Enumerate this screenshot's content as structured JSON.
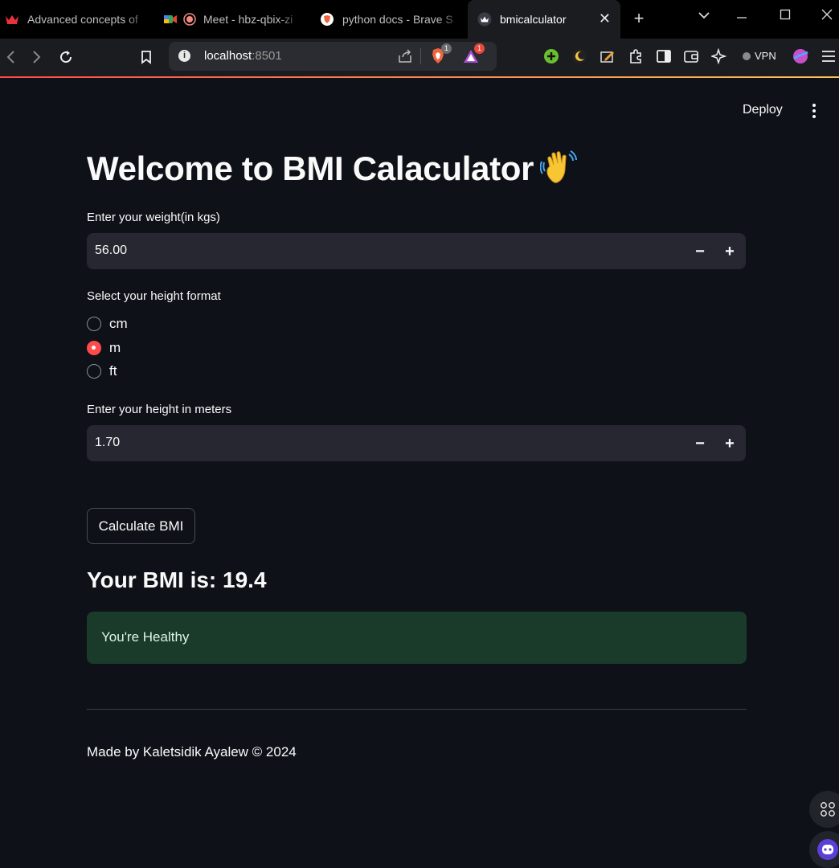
{
  "browser": {
    "tabs": [
      {
        "title": "Advanced concepts of",
        "icon": "brave-crown-icon"
      },
      {
        "title": "Meet - hbz-qbix-zi",
        "icon": "google-meet-icon"
      },
      {
        "title": "python docs - Brave S",
        "icon": "brave-search-icon"
      },
      {
        "title": "bmicalculator",
        "icon": "streamlit-crown-icon",
        "active": true
      }
    ],
    "url_host": "localhost",
    "url_port": ":8501",
    "shields_badge": "1",
    "rewards_badge": "1",
    "vpn_label": "VPN"
  },
  "app": {
    "deploy_label": "Deploy",
    "title": "Welcome to BMI Calaculator",
    "weight": {
      "label": "Enter your weight(in kgs)",
      "value": "56.00",
      "minus": "−",
      "plus": "+"
    },
    "height_format": {
      "label": "Select your height format",
      "options": [
        "cm",
        "m",
        "ft"
      ],
      "selected": "m"
    },
    "height": {
      "label": "Enter your height in meters",
      "value": "1.70",
      "minus": "−",
      "plus": "+"
    },
    "calculate_label": "Calculate BMI",
    "result_text": "Your BMI is: 19.4",
    "status_text": "You're Healthy",
    "footer_text": "Made by Kaletsidik Ayalew © 2024"
  },
  "colors": {
    "background": "#0e1117",
    "primary": "#ff4b4b",
    "input_bg": "#262730",
    "success_bg": "#1a3a2a"
  }
}
